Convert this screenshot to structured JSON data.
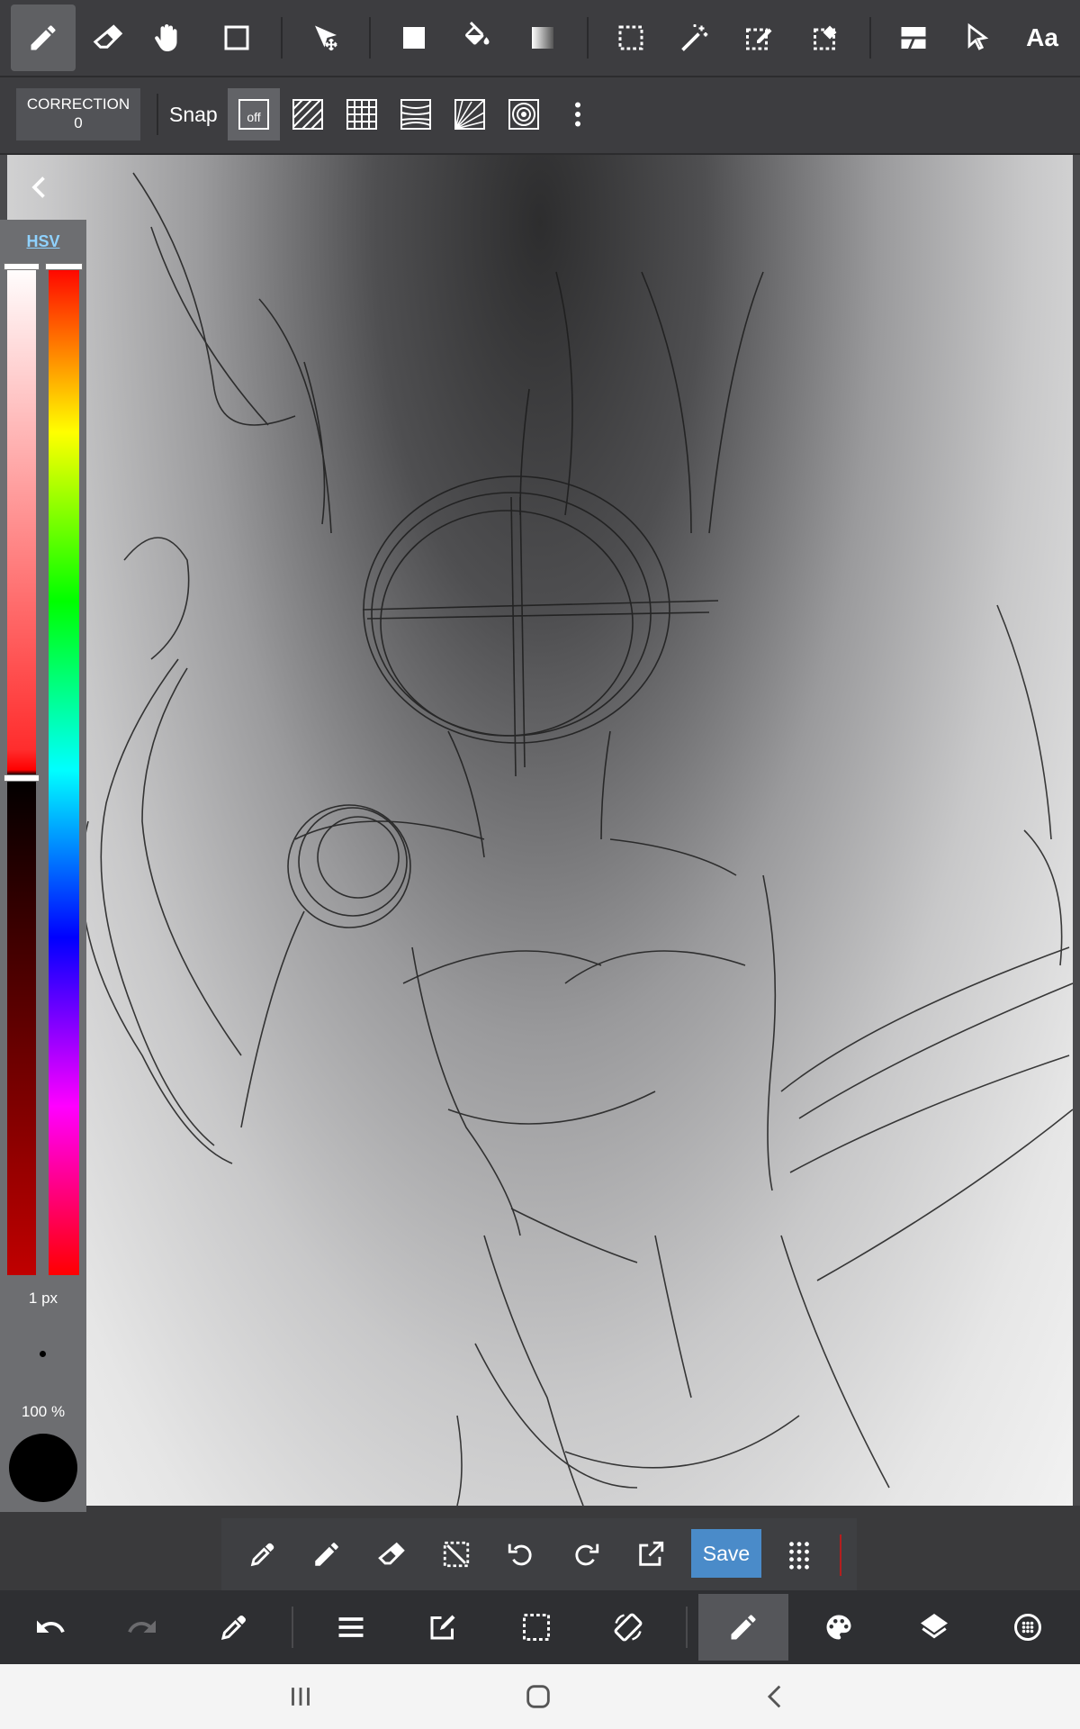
{
  "toolbar": {
    "tools": [
      "pen",
      "eraser",
      "hand",
      "shape",
      "move",
      "fill-rect",
      "bucket",
      "gradient",
      "select-rect",
      "magic-wand",
      "select-pen",
      "select-eraser",
      "layer-effect",
      "pointer",
      "text"
    ],
    "text_tool_label": "Aa"
  },
  "subbar": {
    "correction_label": "CORRECTION",
    "correction_value": "0",
    "snap_label": "Snap",
    "snap_off_label": "off"
  },
  "color_panel": {
    "mode_label": "HSV",
    "brush_size": "1 px",
    "opacity": "100 %",
    "current_color": "#000000"
  },
  "action_bar": {
    "save_label": "Save"
  },
  "colors": {
    "accent": "#4a8bc9",
    "toolbar_bg": "#3d3d40",
    "bottom_bg": "#2e2f32"
  }
}
